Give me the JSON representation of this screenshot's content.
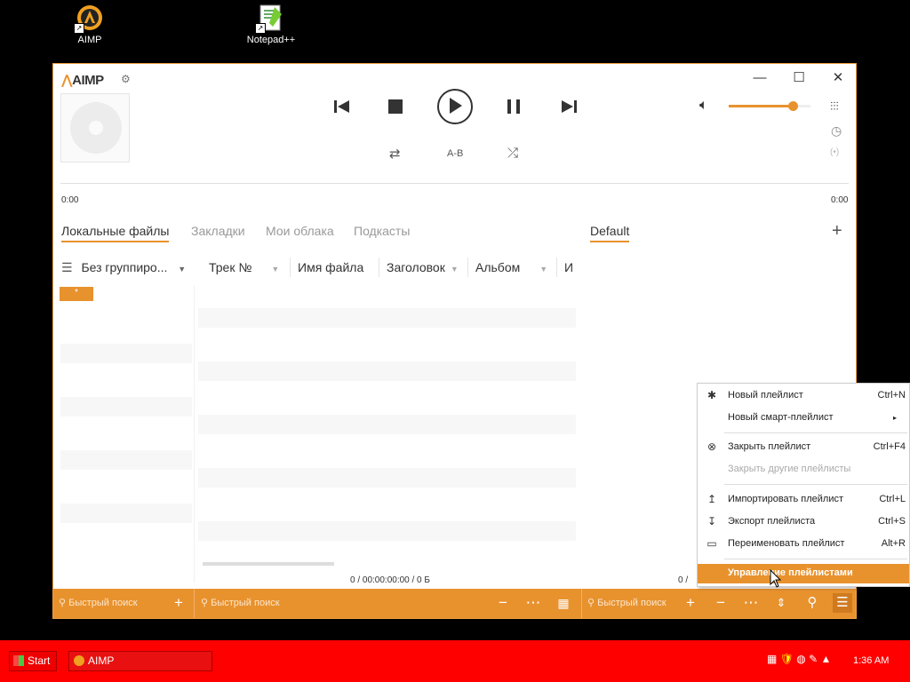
{
  "desktop": {
    "icons": [
      {
        "label": "AIMP"
      },
      {
        "label": "Notepad++"
      }
    ]
  },
  "window": {
    "logo": "AIMP",
    "time_left": "0:00",
    "time_right": "0:00",
    "ab_label": "A-B",
    "volume_fraction": 0.78,
    "tabs": [
      "Локальные файлы",
      "Закладки",
      "Мои облака",
      "Подкасты"
    ],
    "playlist_tab": "Default",
    "grouping_label": "Без группиро...",
    "columns": [
      "Трек №",
      "Имя файла",
      "Заголовок",
      "Альбом",
      "И"
    ],
    "group_badge": "*",
    "status_left": "0 / 00:00:00:00 / 0 Б",
    "status_right": "0 /",
    "search_placeholder_1": "Быстрый поиск",
    "search_placeholder_2": "Быстрый поиск",
    "search_placeholder_3": "Быстрый поиск"
  },
  "context_menu": {
    "items": [
      {
        "label": "Новый плейлист",
        "shortcut": "Ctrl+N"
      },
      {
        "label": "Новый смарт-плейлист",
        "shortcut": "▸"
      },
      {
        "label": "Закрыть плейлист",
        "shortcut": "Ctrl+F4"
      },
      {
        "label": "Закрыть другие плейлисты",
        "shortcut": ""
      },
      {
        "label": "Импортировать плейлист",
        "shortcut": "Ctrl+L"
      },
      {
        "label": "Экспорт плейлиста",
        "shortcut": "Ctrl+S"
      },
      {
        "label": "Переименовать плейлист",
        "shortcut": "Alt+R"
      },
      {
        "label": "Управление плейлистами",
        "shortcut": ""
      }
    ]
  },
  "taskbar": {
    "start_label": "Start",
    "task_label": "AIMP",
    "clock": "1:36 AM"
  },
  "colors": {
    "accent": "#e8922e",
    "taskbar": "#ff0000"
  }
}
